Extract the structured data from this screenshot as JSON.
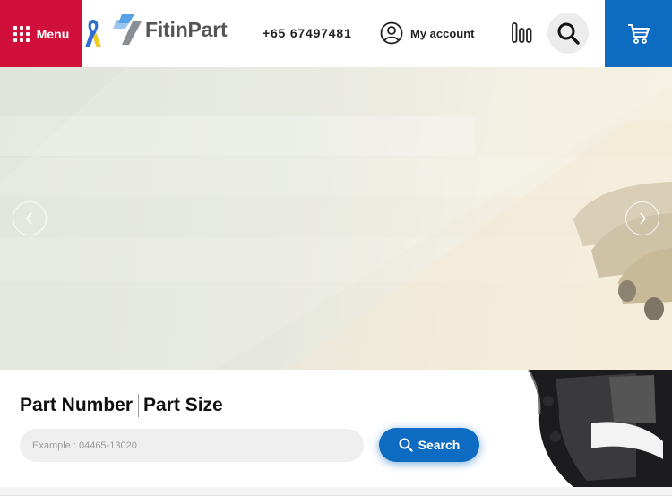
{
  "header": {
    "menu_label": "Menu",
    "brand_name": "FitinPart",
    "phone": "+65 67497481",
    "account_label": "My account"
  },
  "search": {
    "tabs": [
      {
        "label": "Part Number"
      },
      {
        "label": "Part Size"
      }
    ],
    "placeholder": "Example : 04465-13020",
    "button_label": "Search"
  },
  "colors": {
    "menu_bg": "#d0103a",
    "accent_blue": "#0d6cc1",
    "ribbon_blue": "#2f6fd6",
    "ribbon_yellow": "#f5cc1b"
  },
  "icons": {
    "menu": "grid-icon",
    "ribbon": "ribbon-icon",
    "logo": "logo-mark-icon",
    "account": "user-circle-icon",
    "compare": "compare-bars-icon",
    "search": "search-icon",
    "cart": "cart-icon",
    "prev": "chevron-left-icon",
    "next": "chevron-right-icon"
  }
}
